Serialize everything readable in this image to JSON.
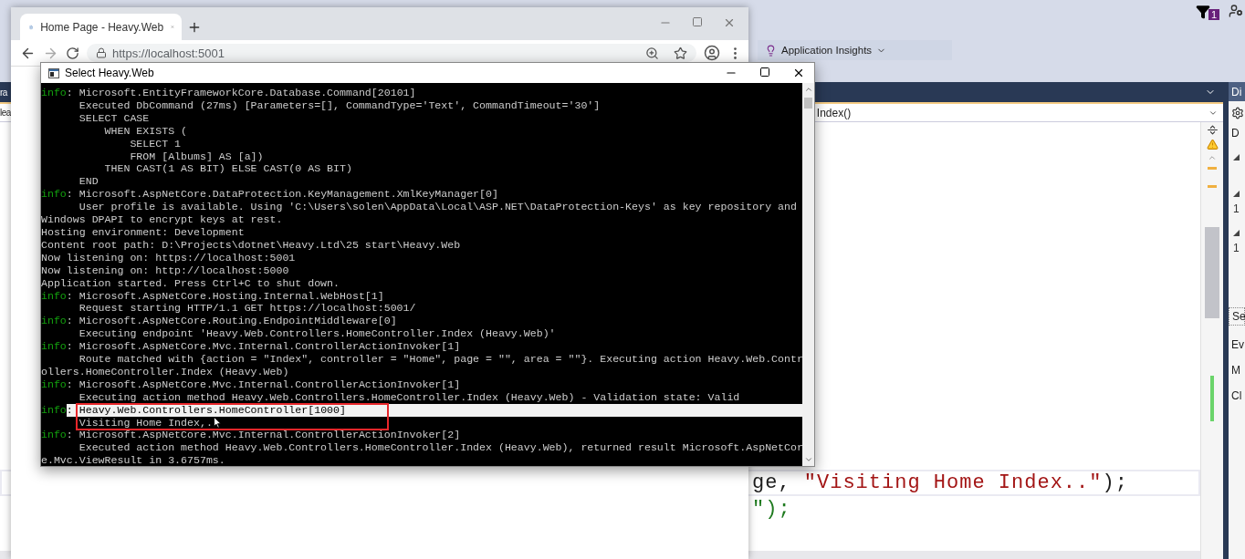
{
  "ide": {
    "notification_count": "1",
    "toolbar": {
      "label": "Application Insights"
    },
    "editor_tab_fragment": "ra",
    "navigation": {
      "left_fragment": "lea",
      "member": "Index()"
    },
    "code_lines": [
      {
        "parts": [
          {
            "kind": "plain",
            "text": "ge, "
          },
          {
            "kind": "string",
            "text": "\"Visiting Home Index..\""
          },
          {
            "kind": "plain",
            "text": ");"
          }
        ]
      },
      {
        "parts": [
          {
            "kind": "comment",
            "text": "\");"
          }
        ]
      }
    ],
    "side_panel": [
      {
        "kind": "tab",
        "text": "Di"
      },
      {
        "kind": "heading",
        "text": "D"
      },
      {
        "kind": "node"
      },
      {
        "kind": "node",
        "text": "1"
      },
      {
        "kind": "node",
        "text": "1"
      },
      {
        "kind": "button",
        "text": "Se"
      },
      {
        "kind": "label",
        "text": "Ev"
      },
      {
        "kind": "label",
        "text": "M"
      },
      {
        "kind": "label",
        "text": "Cl"
      }
    ]
  },
  "browser": {
    "tab": {
      "title": "Home Page - Heavy.Web",
      "selected": true
    },
    "address": "https://localhost:5001"
  },
  "console": {
    "title": "Select Heavy.Web",
    "lines": [
      {
        "level": "info",
        "text": ": Microsoft.EntityFrameworkCore.Database.Command[20101]",
        "selected": false
      },
      {
        "text": "      Executed DbCommand (27ms) [Parameters=[], CommandType='Text', CommandTimeout='30']",
        "selected": false
      },
      {
        "text": "      SELECT CASE",
        "selected": false
      },
      {
        "text": "          WHEN EXISTS (",
        "selected": false
      },
      {
        "text": "              SELECT 1",
        "selected": false
      },
      {
        "text": "              FROM [Albums] AS [a])",
        "selected": false
      },
      {
        "text": "          THEN CAST(1 AS BIT) ELSE CAST(0 AS BIT)",
        "selected": false
      },
      {
        "text": "      END",
        "selected": false
      },
      {
        "level": "info",
        "text": ": Microsoft.AspNetCore.DataProtection.KeyManagement.XmlKeyManager[0]",
        "selected": false
      },
      {
        "text": "      User profile is available. Using 'C:\\Users\\solen\\AppData\\Local\\ASP.NET\\DataProtection-Keys' as key repository and",
        "selected": false
      },
      {
        "text": "Windows DPAPI to encrypt keys at rest.",
        "selected": false
      },
      {
        "text": "Hosting environment: Development",
        "selected": false
      },
      {
        "text": "Content root path: D:\\Projects\\dotnet\\Heavy.Ltd\\25 start\\Heavy.Web",
        "selected": false
      },
      {
        "text": "Now listening on: https://localhost:5001",
        "selected": false
      },
      {
        "text": "Now listening on: http://localhost:5000",
        "selected": false
      },
      {
        "text": "Application started. Press Ctrl+C to shut down.",
        "selected": false
      },
      {
        "level": "info",
        "text": ": Microsoft.AspNetCore.Hosting.Internal.WebHost[1]",
        "selected": false
      },
      {
        "text": "      Request starting HTTP/1.1 GET https://localhost:5001/",
        "selected": false
      },
      {
        "level": "info",
        "text": ": Microsoft.AspNetCore.Routing.EndpointMiddleware[0]",
        "selected": false
      },
      {
        "text": "      Executing endpoint 'Heavy.Web.Controllers.HomeController.Index (Heavy.Web)'",
        "selected": false
      },
      {
        "level": "info",
        "text": ": Microsoft.AspNetCore.Mvc.Internal.ControllerActionInvoker[1]",
        "selected": false
      },
      {
        "text": "      Route matched with {action = \"Index\", controller = \"Home\", page = \"\", area = \"\"}. Executing action Heavy.Web.Contr",
        "selected": false
      },
      {
        "text": "ollers.HomeController.Index (Heavy.Web)",
        "selected": false
      },
      {
        "level": "info",
        "text": ": Microsoft.AspNetCore.Mvc.Internal.ControllerActionInvoker[1]",
        "selected": false
      },
      {
        "text": "      Executing action method Heavy.Web.Controllers.HomeController.Index (Heavy.Web) - Validation state: Valid",
        "selected": false
      },
      {
        "level": "info",
        "text": ": Heavy.Web.Controllers.HomeController[1000]",
        "selected": true
      },
      {
        "text": "      Visiting Home Index,.",
        "selected": false
      },
      {
        "level": "info",
        "text": ": Microsoft.AspNetCore.Mvc.Internal.ControllerActionInvoker[2]",
        "selected": false
      },
      {
        "text": "      Executed action method Heavy.Web.Controllers.HomeController.Index (Heavy.Web), returned result Microsoft.AspNetCor",
        "selected": false
      },
      {
        "text": "e.Mvc.ViewResult in 3.6757ms.",
        "selected": false
      }
    ]
  }
}
